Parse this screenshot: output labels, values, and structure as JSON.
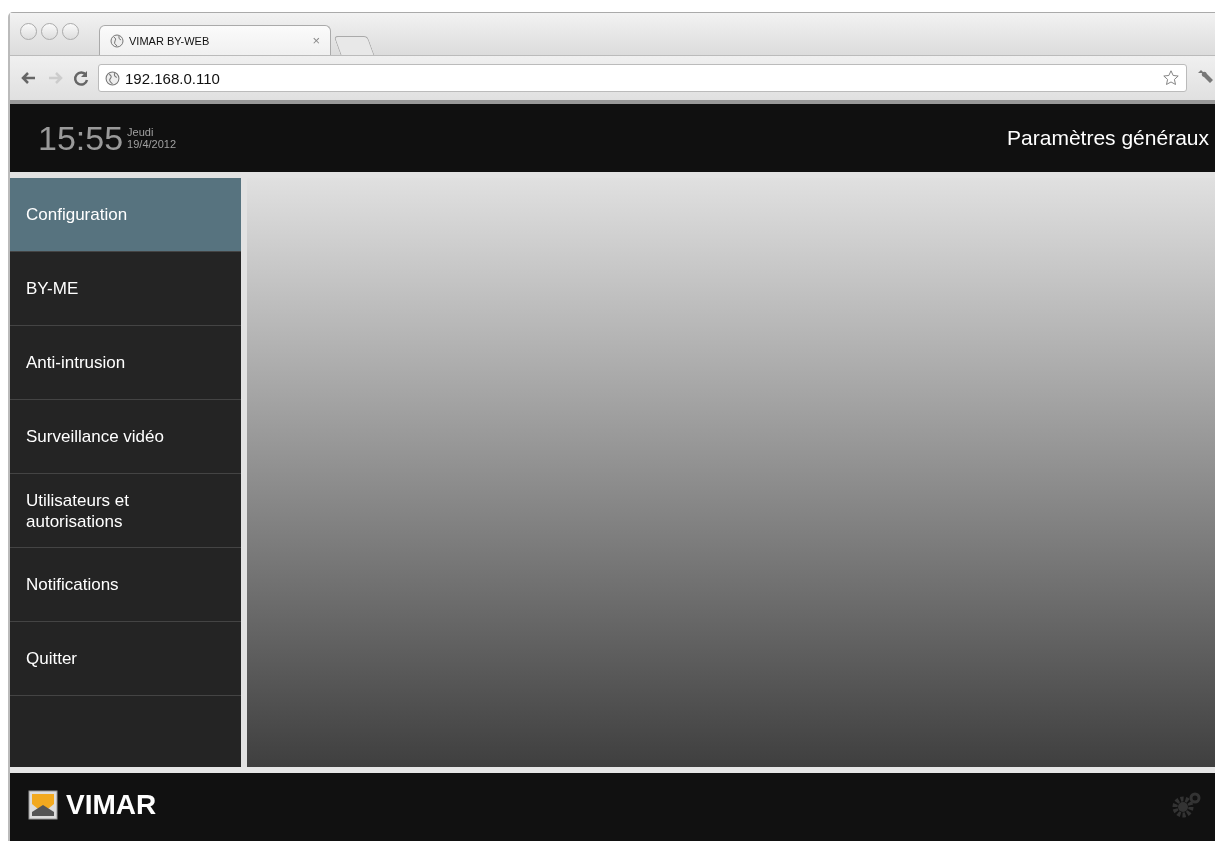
{
  "browser": {
    "tab_title": "VIMAR BY-WEB",
    "tab_close": "×",
    "address": "192.168.0.110"
  },
  "header": {
    "time": "15:55",
    "day": "Jeudi",
    "date": "19/4/2012",
    "title": "Paramètres généraux"
  },
  "sidebar": {
    "items": [
      {
        "label": "Configuration",
        "selected": true
      },
      {
        "label": "BY-ME",
        "selected": false
      },
      {
        "label": "Anti-intrusion",
        "selected": false
      },
      {
        "label": "Surveillance vidéo",
        "selected": false
      },
      {
        "label": "Utilisateurs et autorisations",
        "selected": false
      },
      {
        "label": "Notifications",
        "selected": false
      },
      {
        "label": "Quitter",
        "selected": false
      }
    ]
  },
  "footer": {
    "brand": "VIMAR"
  }
}
